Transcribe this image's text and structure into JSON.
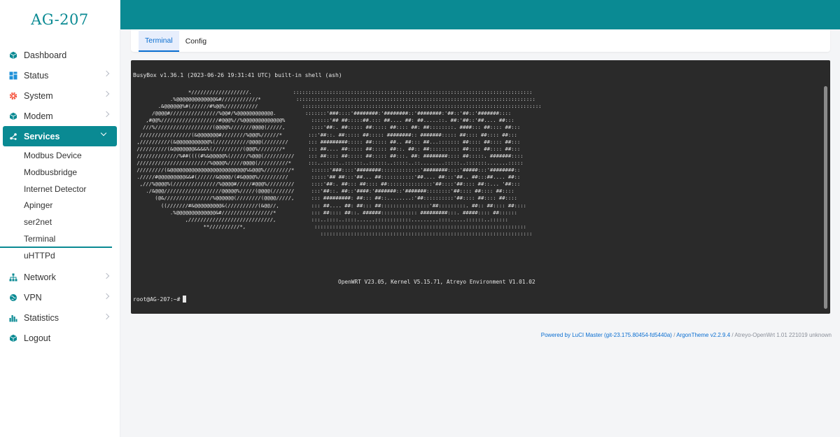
{
  "brand": "AG-207",
  "sidebar": {
    "items": [
      {
        "key": "dashboard",
        "label": "Dashboard",
        "icon": "cube-icon",
        "has_children": false
      },
      {
        "key": "status",
        "label": "Status",
        "icon": "grid-icon",
        "has_children": true
      },
      {
        "key": "system",
        "label": "System",
        "icon": "gear-icon",
        "has_children": true
      },
      {
        "key": "modem",
        "label": "Modem",
        "icon": "cube-icon",
        "has_children": true
      },
      {
        "key": "services",
        "label": "Services",
        "icon": "share-icon",
        "has_children": true,
        "expanded": true
      },
      {
        "key": "network",
        "label": "Network",
        "icon": "network-icon",
        "has_children": true
      },
      {
        "key": "vpn",
        "label": "VPN",
        "icon": "globe-icon",
        "has_children": true
      },
      {
        "key": "statistics",
        "label": "Statistics",
        "icon": "bar-chart-icon",
        "has_children": true
      },
      {
        "key": "logout",
        "label": "Logout",
        "icon": "cube-icon",
        "has_children": false
      }
    ],
    "services_submenu": [
      {
        "label": "Modbus Device"
      },
      {
        "label": "Modbusbridge"
      },
      {
        "label": "Internet Detector"
      },
      {
        "label": "Apinger"
      },
      {
        "label": "ser2net"
      },
      {
        "label": "Terminal",
        "active": true
      },
      {
        "label": "uHTTPd"
      }
    ]
  },
  "tabs": [
    {
      "label": "Terminal",
      "active": true
    },
    {
      "label": "Config",
      "active": false
    }
  ],
  "terminal": {
    "busybox": "BusyBox v1.36.1 (2023-06-26 19:31:41 UTC) built-in shell (ash)",
    "art_left": "                  *///////////////////.\n            .%@@@@@@@@@@@@@&#////////////*\n        .&@@@@@@%#(//////#%@@%///////////\n      /@@@@#////////////////%@@#/%@@@@@@@@@@@@.\n    ,#@@%///////////////////#@@@%//%@@@@@@@@@@@@@%\n   ///%///////////////////(@@@@%///////@@@@(/////,\n  /////////////////(&@@@@@@@#////////%@@@%//////*\n ,//////////(&@@@@@@@@@@@%(///////////@@@@(////////\n //////////(&@@@@@@@&&&&%(//////////(@@@%////////*\n //////////////%##((((#%&@@@@@%(//////%@@@(//////////\n ////////////////////////%@@@@%/////@@@@(//////////*\n /////////(&@@@@@@@@@@@@@@@@@@@@@@@@@%&@@@%/////////*\n ./////#@@@@@@@@@&&#(//////&@@@@/(#&@@@@%//////////\n  ,///%@@@@%(///////////////%@@@@#/////#@@@%/////////\n    ./&@@@///////////////////@@@@@%/////(@@@@(///////\n       (@&////////////////%@@@@@@(////////(@@@@/////,\n         ((///////#&@@@@@@@@@&(//////////(&@@//,\n            .%@@@@@@@@@@@@@&#/////////////////*\n                 ,////////////////////////////,\n                       **//////////*,",
    "art_right": "  :::::::::::::::::::::::::::::::::::::::::::::::::::::::::::::::::::::::::::::::\n   :::::::::::::::::::::::::::::::::::::::::::::::::::::::::::::::::::::::::::::::\n     :::::::::::::::::::::::::::::::::::::::::::::::::::::::::::::::::::::::::::::::\n      :::::::'###::::'########:'########::'########:'##::'##::'#######::::\n        ::::::'## ##:::::##.::: ##.... ##: ##.....::. ##:'##::'##.... ##:::\n        ::::'##:. ##::::: ##::::: ##:::: ##: ##::::::::. ####::: ##:::: ##:::\n       :::'##::. ##::::: ##::::: ########:: #######::::: ##:::: ##:::: ##:::\n       ::: #########::::: ##::::: ##.. ##::: ##...::::::: ##:::: ##:::: ##:::\n       ::: ##.... ##::::: ##::::: ##::. ##:: ##:::::::::: ##:::: ##:::: ##:::\n       ::: ##:::: ##::::: ##::::: ##:::. ##: ########:::: ##:::::. #######::::\n       :::..:::::..::::::..::::::..:::::..::........:::::..:::::::.......:::::\n        ::::::'###::::'########:::::::::::::'########::::'#####:::'########::\n        :::::'## ##:::'##... ##:::::::::::'##.... ##:::'##.. ##:::##.... ##::\n        ::::'##:. ##::: ##:::: ##:::::::::::::::'##::::'##:::: ##::... '##:::\n        :::'##::. ##::'####:'#######::'#######::::::::'##:::: ##:::: ##::::\n        ::: #########: ##::: ##::........:'##::::::::::'##:::: ##:::: ##::::\n        ::: ##.... ##: ##::: ##::::::::::::::::'##:::::::::. ##:: ##:::: ##::::\n        ::: ##:::: ##::. ######:::::::::::: #########:::. #####:::: ##::::::\n        :::..::::..::::......::::::::::::.........::::.....::::::..::::::\n         ::::::::::::::::::::::::::::::::::::::::::::::::::::::::::::::::::::::\n           ::::::::::::::::::::::::::::::::::::::::::::::::::::::::::::::::::::::",
    "version": "OpenWRT V23.05, Kernel V5.15.71, Atreyo Environment V1.01.02",
    "prompt": "root@AG-207:~#"
  },
  "footer": {
    "link1": "Powered by LuCI Master (git-23.175.80454-fd5440a)",
    "sep1": " / ",
    "link2": "ArgonTheme v2.2.9.4",
    "sep2": " / ",
    "version_text": "Atreyo-OpenWrt 1.01 221019 unknown"
  },
  "colors": {
    "accent": "#0a8a93",
    "tab_active": "#0a6ed1",
    "terminal_bg": "#2a2a2a",
    "page_bg": "#f4f5f7"
  }
}
